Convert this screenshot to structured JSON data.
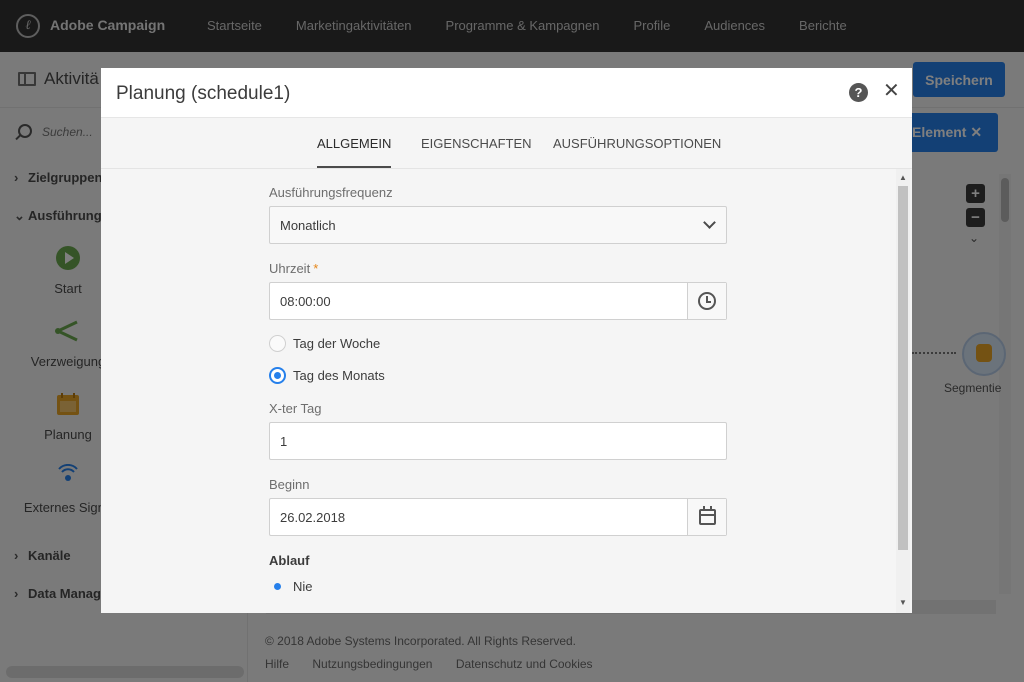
{
  "app": {
    "brand": "Adobe Campaign",
    "nav": [
      "Startseite",
      "Marketingaktivitäten",
      "Programme & Kampagnen",
      "Profile",
      "Audiences",
      "Berichte"
    ]
  },
  "page": {
    "title": "Aktivitä",
    "save_label": "Speichern",
    "element_label": "Element",
    "search_placeholder": "Suchen..."
  },
  "sidebar": {
    "sections": {
      "zielgruppen": "Zielgruppen",
      "ausfuehrung": "Ausführung",
      "kanaele": "Kanäle",
      "data": "Data Manag"
    },
    "activities": {
      "start": "Start",
      "verzweigung": "Verzweigung",
      "planung": "Planung",
      "externes": "Externes Signa"
    }
  },
  "canvas": {
    "node_label": "Segmentie"
  },
  "footer": {
    "copyright": "© 2018 Adobe Systems Incorporated. All Rights Reserved.",
    "links": [
      "Hilfe",
      "Nutzungsbedingungen",
      "Datenschutz und Cookies"
    ]
  },
  "dialog": {
    "title": "Planung (schedule1)",
    "help": "?",
    "close": "✕",
    "tabs": [
      "ALLGEMEIN",
      "EIGENSCHAFTEN",
      "AUSFÜHRUNGSOPTIONEN"
    ],
    "frequency_label": "Ausführungsfrequenz",
    "frequency_value": "Monatlich",
    "time_label": "Uhrzeit",
    "time_required": "*",
    "time_value": "08:00:00",
    "radio_weekday": "Tag der Woche",
    "radio_monthday": "Tag des Monats",
    "nth_day_label": "X-ter Tag",
    "nth_day_value": "1",
    "start_label": "Beginn",
    "start_value": "26.02.2018",
    "expiry_label": "Ablauf",
    "expiry_never": "Nie"
  },
  "colors": {
    "accent": "#2680eb",
    "topbar": "#323232",
    "required": "#e68619"
  }
}
